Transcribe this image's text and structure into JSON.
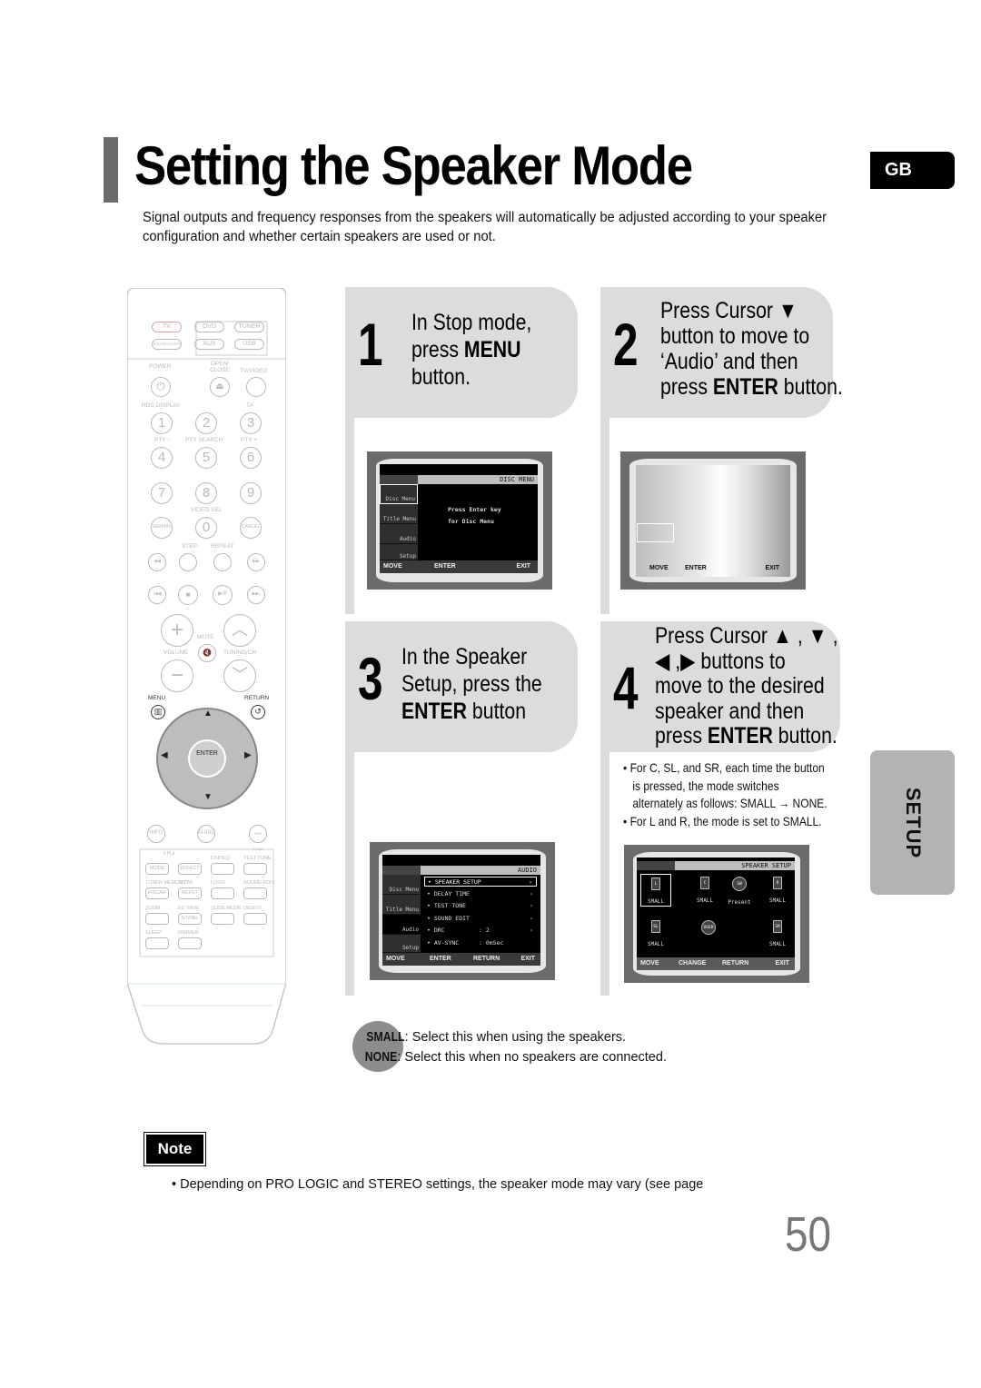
{
  "page": {
    "title": "Setting the Speaker Mode",
    "language_badge": "GB",
    "intro": "Signal outputs and frequency responses from the speakers will automatically be adjusted according to your speaker configuration and whether certain speakers are used or not.",
    "section_tab": "SETUP",
    "page_number": "50"
  },
  "remote": {
    "source_buttons": [
      "TV",
      "DVD",
      "TUNER",
      "DND RECEIVER",
      "AUX",
      "USB"
    ],
    "labels": {
      "power": "POWER",
      "open_close": "OPEN/ CLOSE",
      "tv_video": "TV/VIDEO",
      "rds_display": "RDS DISPLAY",
      "ta": "TA",
      "pty_minus": "PTY -",
      "pty_search": "PTY SEARCH",
      "pty_plus": "PTY +",
      "video_sel": "VIDEO SEL",
      "remain": "REMAIN",
      "cancel": "CANCEL",
      "step": "STEP",
      "repeat": "REPEAT",
      "mute": "MUTE",
      "volume": "VOLUME",
      "tuning_ch": "TUNING/CH",
      "menu": "MENU",
      "return": "RETURN",
      "enter": "ENTER",
      "info": "INFO",
      "audio": "AUDIO",
      "subtitle": "SUB TITLE"
    },
    "digits": [
      "1",
      "2",
      "3",
      "4",
      "5",
      "6",
      "7",
      "8",
      "9",
      "0"
    ],
    "lower_grid": [
      {
        "label": "",
        "button": "MODE"
      },
      {
        "label": "",
        "button": "EFFECT"
      },
      {
        "label": "DSP/EQ",
        "button": ""
      },
      {
        "label": "TEST TONE",
        "button": ""
      },
      {
        "label": "TUNER MEMORY",
        "button": "P.SCAN"
      },
      {
        "label": "SLOW",
        "button": "MO/ST"
      },
      {
        "label": "LOGO",
        "button": ""
      },
      {
        "label": "SOUND EDIT",
        "button": ""
      },
      {
        "label": "ZOOM",
        "button": ""
      },
      {
        "label": "EZ VIEW",
        "button": "NT/PAL"
      },
      {
        "label": "SLIDE MODE",
        "button": ""
      },
      {
        "label": "DIGEST",
        "button": ""
      },
      {
        "label": "SLEEP",
        "button": ""
      },
      {
        "label": "DIMMER",
        "button": ""
      }
    ],
    "pl_label": "Ⅱ PLⅡ"
  },
  "steps": [
    {
      "number": "1",
      "lines": [
        [
          "In Stop mode,"
        ],
        [
          "press ",
          "MENU"
        ],
        [
          "button."
        ]
      ]
    },
    {
      "number": "2",
      "lines": [
        [
          "Press Cursor ▼"
        ],
        [
          "button to move to"
        ],
        [
          "‘Audio’ and then"
        ],
        [
          "press ",
          "ENTER",
          " button."
        ]
      ]
    },
    {
      "number": "3",
      "lines": [
        [
          "In the Speaker"
        ],
        [
          "Setup, press the"
        ],
        [
          "",
          "ENTER",
          " button"
        ]
      ]
    },
    {
      "number": "4",
      "lines": [
        [
          "Press Cursor ▲ , ▼ ,"
        ],
        [
          "◀ ,▶ buttons to"
        ],
        [
          "move to the desired"
        ],
        [
          "speaker and then"
        ],
        [
          "press ",
          "ENTER",
          " button."
        ]
      ]
    }
  ],
  "screens": {
    "disc_menu": {
      "header": "DISC MENU",
      "side": [
        "Disc Menu",
        "Title Menu",
        "Audio",
        "Setup"
      ],
      "message": [
        "Press Enter key",
        "for Disc Menu"
      ],
      "footer": [
        "MOVE",
        "ENTER",
        "EXIT"
      ]
    },
    "blank": {
      "footer": [
        "MOVE",
        "ENTER",
        "EXIT"
      ]
    },
    "audio_menu": {
      "header": "AUDIO",
      "side": [
        "Disc Menu",
        "Title Menu",
        "Audio",
        "Setup"
      ],
      "items": [
        {
          "label": "SPEAKER SETUP",
          "value": "",
          "arrow": "›",
          "selected": true
        },
        {
          "label": "DELAY TIME",
          "value": "",
          "arrow": "›"
        },
        {
          "label": "TEST TONE",
          "value": "",
          "arrow": "›"
        },
        {
          "label": "SOUND EDIT",
          "value": "",
          "arrow": "›"
        },
        {
          "label": "DRC",
          "value": ": 2",
          "arrow": "›"
        },
        {
          "label": "AV-SYNC",
          "value": ": 0mSec",
          "arrow": ""
        }
      ],
      "footer": [
        "MOVE",
        "ENTER",
        "RETURN",
        "EXIT"
      ]
    },
    "speaker_setup": {
      "header": "SPEAKER SETUP",
      "speakers": [
        {
          "id": "L",
          "mode": "SMALL",
          "selected": true
        },
        {
          "id": "C",
          "mode": "SMALL"
        },
        {
          "id": "SW",
          "mode": "Present"
        },
        {
          "id": "R",
          "mode": "SMALL"
        },
        {
          "id": "SL",
          "mode": "SMALL"
        },
        {
          "id": "USER",
          "mode": ""
        },
        {
          "id": "SR",
          "mode": "SMALL"
        }
      ],
      "footer": [
        "MOVE",
        "CHANGE",
        "RETURN",
        "EXIT"
      ]
    }
  },
  "step4_bullets": [
    "For C, SL, and SR, each time the button",
    "is pressed, the mode switches",
    "alternately as follows: SMALL → NONE.",
    "For L and R, the mode is set to SMALL."
  ],
  "legend": [
    {
      "term": "SMALL",
      "desc": ": Select this when using the speakers."
    },
    {
      "term": "NONE",
      "desc": ": Select this when no speakers are connected."
    }
  ],
  "note": {
    "label": "Note",
    "text": "Depending on PRO LOGIC and STEREO settings, the speaker mode may vary (see page"
  }
}
